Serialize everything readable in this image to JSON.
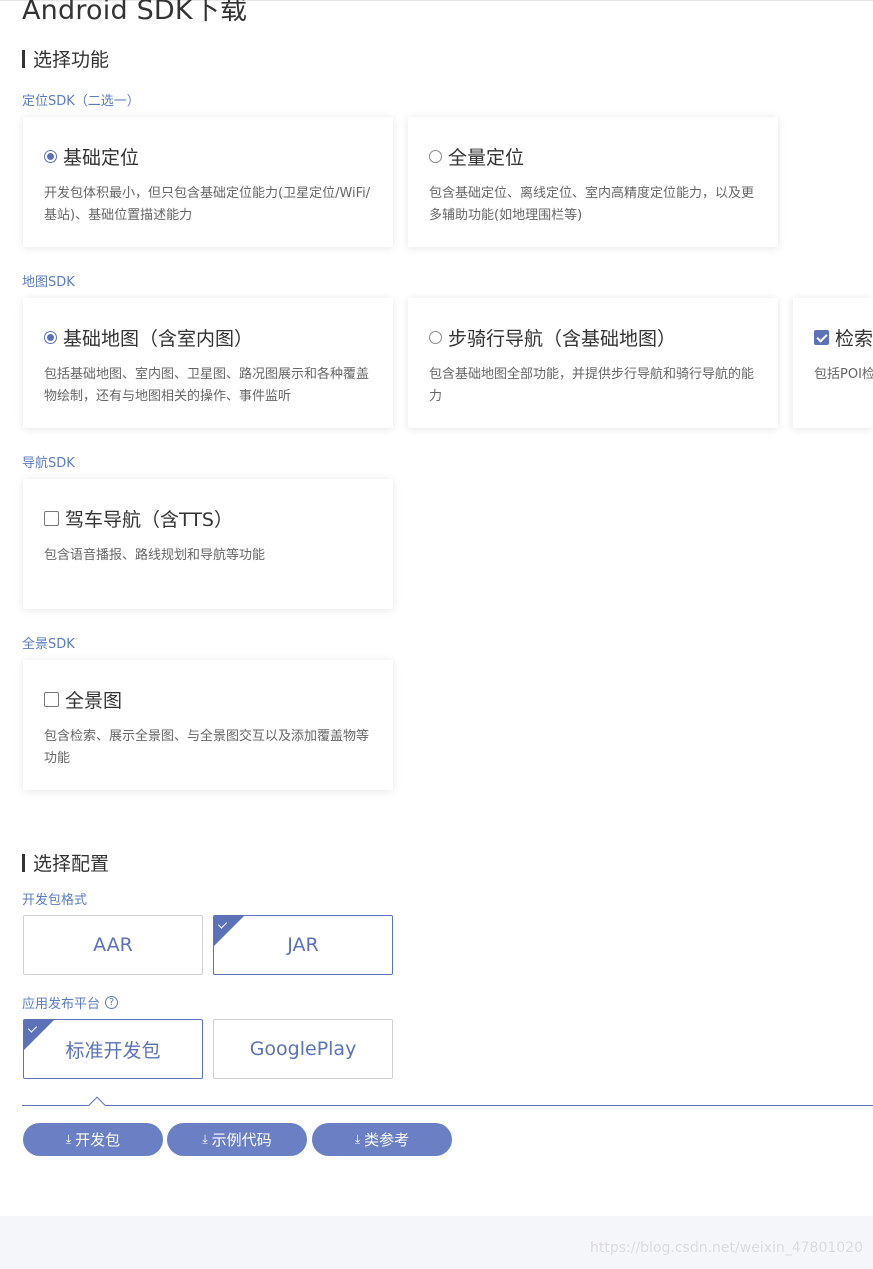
{
  "page": {
    "title": "Android SDK下载"
  },
  "feature_section": {
    "title": "选择功能",
    "groups": [
      {
        "label": "定位SDK（二选一）",
        "cards": [
          {
            "name": "基础定位",
            "desc": "开发包体积最小，但只包含基础定位能力(卫星定位/WiFi/基站)、基础位置描述能力",
            "control": "radio",
            "selected": true
          },
          {
            "name": "全量定位",
            "desc": "包含基础定位、离线定位、室内高精度定位能力，以及更多辅助功能(如地理围栏等)",
            "control": "radio",
            "selected": false
          }
        ]
      },
      {
        "label": "地图SDK",
        "cards": [
          {
            "name": "基础地图（含室内图）",
            "desc": "包括基础地图、室内图、卫星图、路况图展示和各种覆盖物绘制，还有与地图相关的操作、事件监听",
            "control": "radio",
            "selected": true
          },
          {
            "name": "步骑行导航（含基础地图）",
            "desc": "包含基础地图全部功能，并提供步行导航和骑行导航的能力",
            "control": "radio",
            "selected": false
          },
          {
            "name": "检索",
            "desc": "包括POI检",
            "control": "checkbox",
            "selected": true
          }
        ]
      },
      {
        "label": "导航SDK",
        "cards": [
          {
            "name": "驾车导航（含TTS）",
            "desc": "包含语音播报、路线规划和导航等功能",
            "control": "checkbox",
            "selected": false
          }
        ]
      },
      {
        "label": "全景SDK",
        "cards": [
          {
            "name": "全景图",
            "desc": "包含检索、展示全景图、与全景图交互以及添加覆盖物等功能",
            "control": "checkbox",
            "selected": false
          }
        ]
      }
    ]
  },
  "config_section": {
    "title": "选择配置",
    "package_format": {
      "label": "开发包格式",
      "options": [
        {
          "label": "AAR",
          "selected": false
        },
        {
          "label": "JAR",
          "selected": true
        }
      ]
    },
    "platform": {
      "label": "应用发布平台",
      "help": "?",
      "options": [
        {
          "label": "标准开发包",
          "selected": true
        },
        {
          "label": "GooglePlay",
          "selected": false
        }
      ]
    }
  },
  "downloads": {
    "icon": "download-icon",
    "buttons": [
      {
        "label": "开发包"
      },
      {
        "label": "示例代码"
      },
      {
        "label": "类参考"
      }
    ]
  },
  "watermark": "https://blog.csdn.net/weixin_47801020",
  "colors": {
    "accent": "#5b72b8",
    "button": "#6b80c4",
    "link": "#5b7bc0"
  }
}
